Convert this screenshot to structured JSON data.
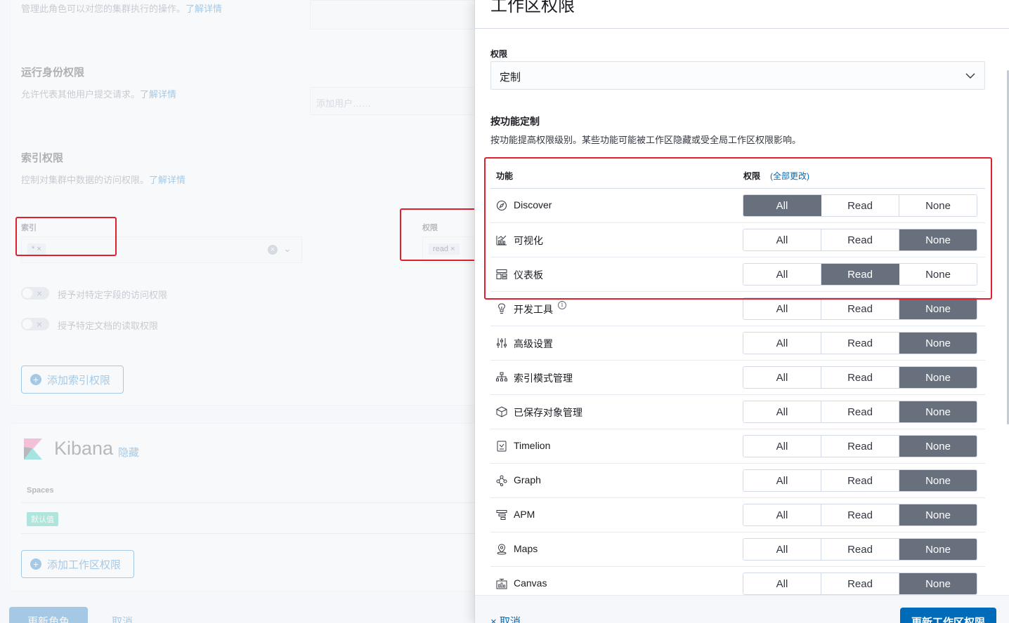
{
  "background": {
    "cluster_desc": "管理此角色可以对您的集群执行的操作。",
    "cluster_link": "了解详情",
    "runas_title": "运行身份权限",
    "runas_desc": "允许代表其他用户提交请求。",
    "runas_link": "了解详情",
    "runas_placeholder": "添加用户……",
    "index_title": "索引权限",
    "index_desc": "控制对集群中数据的访问权限。",
    "index_link": "了解详情",
    "index_label": "索引",
    "index_chip": "*",
    "priv_label": "权限",
    "priv_chip": "read",
    "field_toggle_label": "授予对特定字段的访问权限",
    "doc_toggle_label": "授予特定文档的读取权限",
    "add_index_button": "添加索引权限",
    "kibana_title": "Kibana",
    "kibana_hide_link": "隐藏",
    "spaces_header": "Spaces",
    "default_badge": "默认值",
    "add_space_button": "添加工作区权限",
    "update_role_button": "更新角色",
    "cancel_link": "取消"
  },
  "flyout": {
    "title": "工作区权限",
    "privilege_label": "权限",
    "privilege_value": "定制",
    "customize_title": "按功能定制",
    "customize_desc": "按功能提高权限级别。某些功能可能被工作区隐藏或受全局工作区权限影响。",
    "table": {
      "col_feature": "功能",
      "col_privilege": "权限",
      "change_all_link": "(全部更改)"
    },
    "options": [
      "All",
      "Read",
      "None"
    ],
    "features": [
      {
        "name": "Discover",
        "icon": "compass-icon",
        "selected": "All"
      },
      {
        "name": "可视化",
        "icon": "visualize-icon",
        "selected": "None"
      },
      {
        "name": "仪表板",
        "icon": "dashboard-icon",
        "selected": "Read"
      },
      {
        "name": "开发工具",
        "icon": "devtools-icon",
        "selected": "None",
        "info": "i"
      },
      {
        "name": "高级设置",
        "icon": "settings-sliders-icon",
        "selected": "None"
      },
      {
        "name": "索引模式管理",
        "icon": "index-pattern-icon",
        "selected": "None"
      },
      {
        "name": "已保存对象管理",
        "icon": "saved-objects-icon",
        "selected": "None"
      },
      {
        "name": "Timelion",
        "icon": "timelion-icon",
        "selected": "None"
      },
      {
        "name": "Graph",
        "icon": "graph-icon",
        "selected": "None"
      },
      {
        "name": "APM",
        "icon": "apm-icon",
        "selected": "None"
      },
      {
        "name": "Maps",
        "icon": "maps-icon",
        "selected": "None"
      },
      {
        "name": "Canvas",
        "icon": "canvas-icon",
        "selected": "None"
      }
    ],
    "footer": {
      "cancel_label": "取消",
      "save_label": "更新工作区权限"
    }
  },
  "colors": {
    "accent": "#006bb8",
    "selected_segment": "#69707d",
    "highlight_box": "#e0202f"
  }
}
